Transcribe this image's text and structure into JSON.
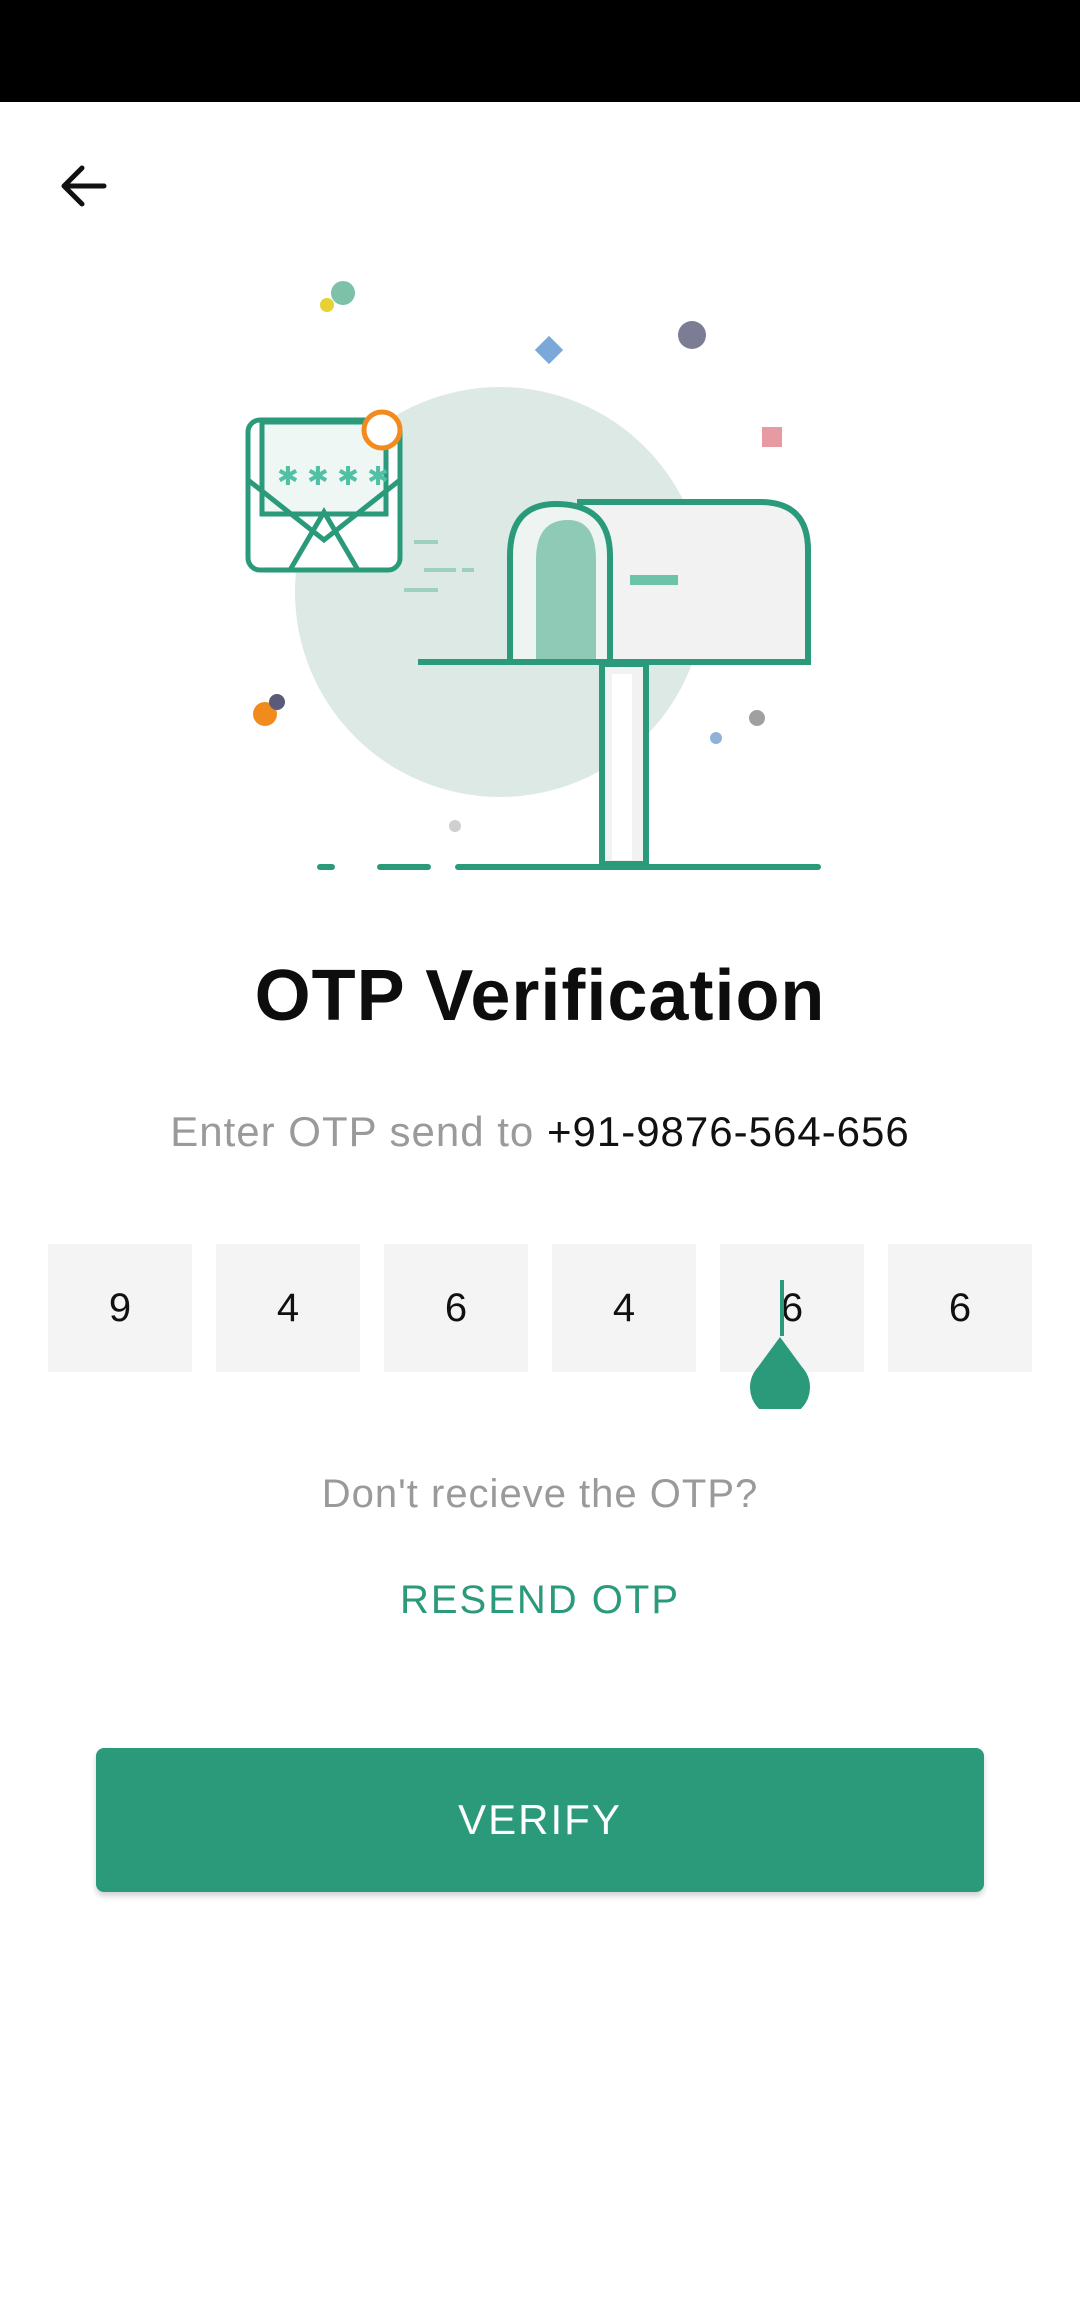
{
  "header": {
    "back_icon": "arrow-left-icon"
  },
  "illustration": {
    "name": "mailbox-otp-illustration",
    "accent": "#2b9a7b"
  },
  "title": "OTP Verification",
  "subtitle": {
    "prefix": "Enter OTP send to",
    "phone": "+91-9876-564-656"
  },
  "otp": {
    "digits": [
      "9",
      "4",
      "6",
      "4",
      "6",
      "6"
    ]
  },
  "resend": {
    "question": "Don't recieve the OTP?",
    "link": "RESEND OTP"
  },
  "verify_button": {
    "label": "VERIFY"
  },
  "colors": {
    "primary": "#2b9a7b",
    "box_bg": "#f4f4f4",
    "muted_text": "#9a9a9a"
  }
}
